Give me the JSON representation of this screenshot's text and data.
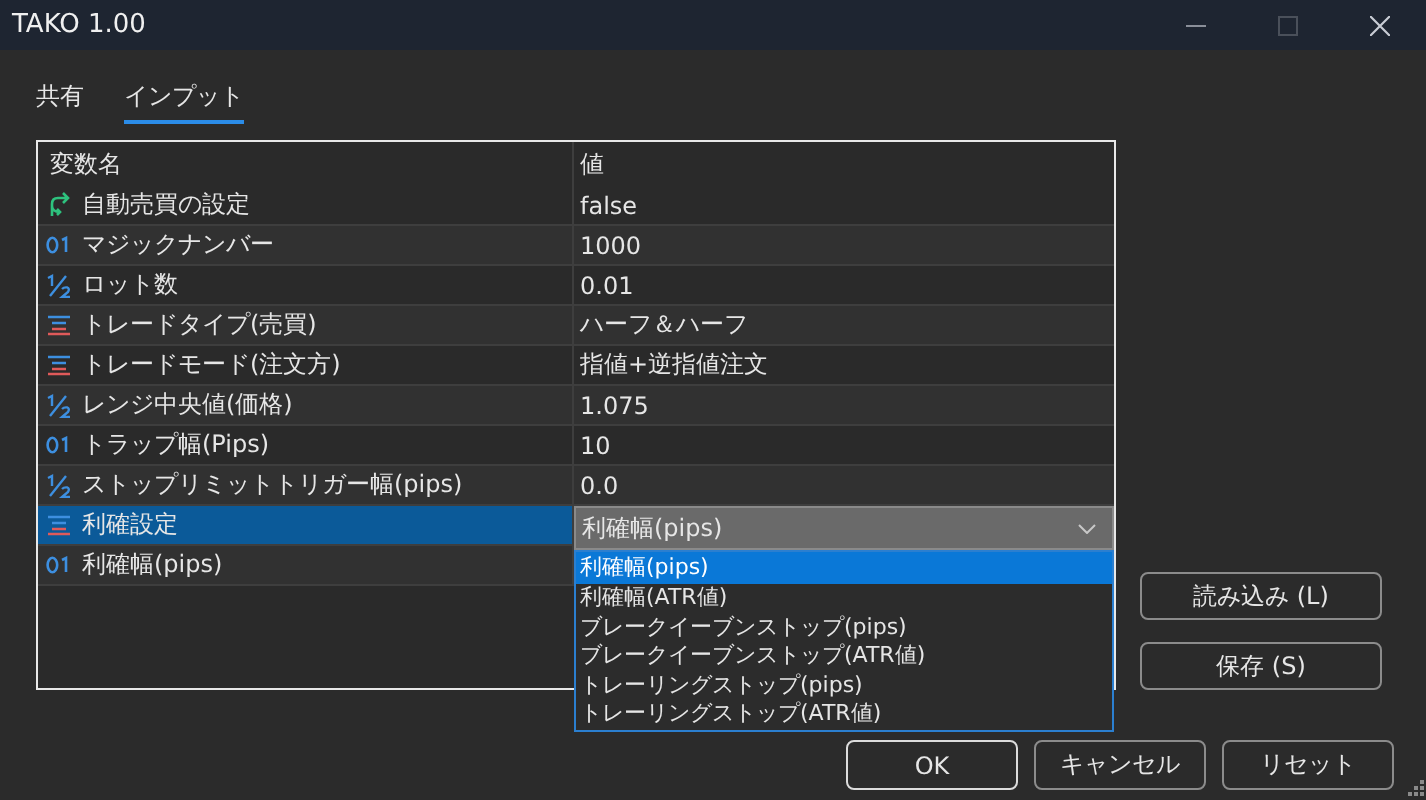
{
  "window": {
    "title": "TAKO 1.00"
  },
  "tabs": [
    {
      "label": "共有",
      "selected": false
    },
    {
      "label": "インプット",
      "selected": true
    }
  ],
  "table": {
    "columns": [
      "変数名",
      "値"
    ],
    "rows": [
      {
        "kind": "bool",
        "name": "自動売買の設定",
        "value": "false",
        "selected": false
      },
      {
        "kind": "int",
        "name": "マジックナンバー",
        "value": "1000",
        "selected": false
      },
      {
        "kind": "double",
        "name": "ロット数",
        "value": "0.01",
        "selected": false
      },
      {
        "kind": "enum",
        "name": "トレードタイプ(売買)",
        "value": "ハーフ＆ハーフ",
        "selected": false
      },
      {
        "kind": "enum",
        "name": "トレードモード(注文方)",
        "value": "指値+逆指値注文",
        "selected": false
      },
      {
        "kind": "double",
        "name": "レンジ中央値(価格)",
        "value": "1.075",
        "selected": false
      },
      {
        "kind": "int",
        "name": "トラップ幅(Pips)",
        "value": "10",
        "selected": false
      },
      {
        "kind": "double",
        "name": "ストップリミットトリガー幅(pips)",
        "value": "0.0",
        "selected": false
      },
      {
        "kind": "enum",
        "name": "利確設定",
        "value": "利確幅(pips)",
        "selected": true,
        "dropdown": true
      },
      {
        "kind": "int",
        "name": "利確幅(pips)",
        "selected": false
      }
    ]
  },
  "dropdown_options": [
    {
      "label": "利確幅(pips)",
      "selected": true
    },
    {
      "label": "利確幅(ATR値)",
      "selected": false
    },
    {
      "label": "ブレークイーブンストップ(pips)",
      "selected": false
    },
    {
      "label": "ブレークイーブンストップ(ATR値)",
      "selected": false
    },
    {
      "label": "トレーリングストップ(pips)",
      "selected": false
    },
    {
      "label": "トレーリングストップ(ATR値)",
      "selected": false
    }
  ],
  "side_buttons": [
    "読み込み (L)",
    "保存 (S)"
  ],
  "buttons": [
    {
      "label": "OK",
      "default": true
    },
    {
      "label": "キャンセル",
      "default": false
    },
    {
      "label": "リセット",
      "default": false
    }
  ]
}
